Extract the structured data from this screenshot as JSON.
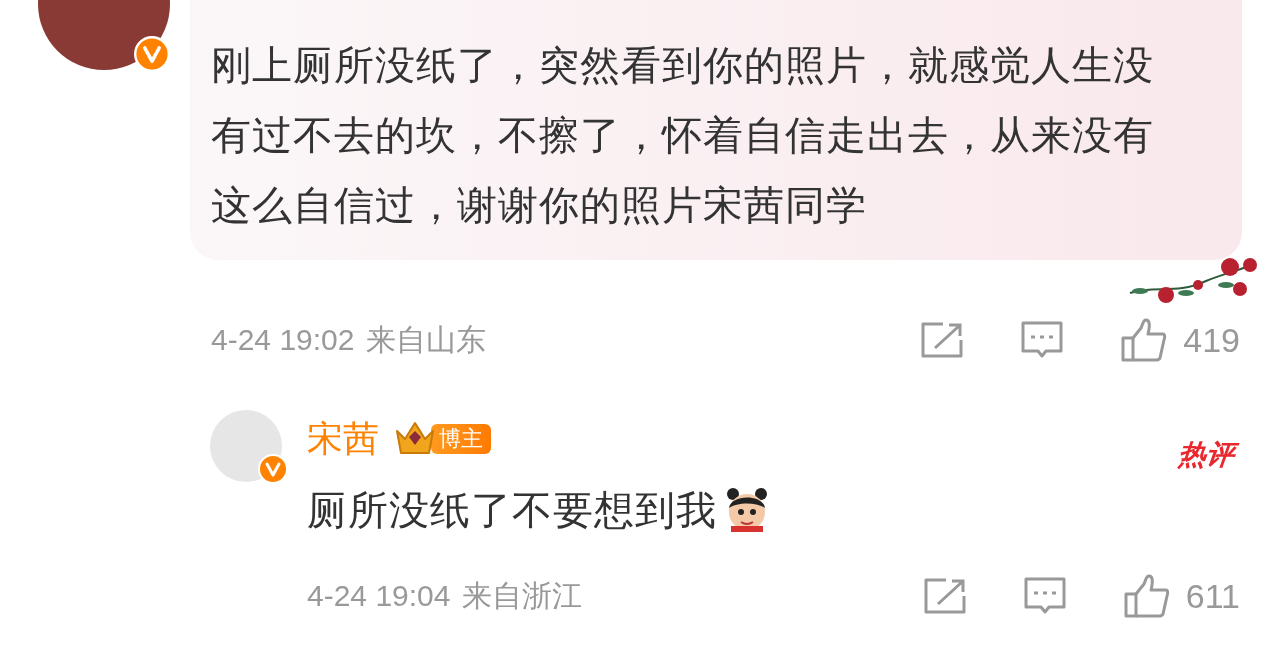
{
  "comment": {
    "text": "刚上厕所没纸了，突然看到你的照片，就感觉人生没有过不去的坎，不擦了，怀着自信走出去，从来没有这么自信过，谢谢你的照片宋茜同学",
    "time": "4-24 19:02",
    "location": "来自山东",
    "likes": "419"
  },
  "reply": {
    "author": "宋茜",
    "badge": "博主",
    "tag": "热评",
    "text": "厕所没纸了不要想到我",
    "time": "4-24 19:04",
    "location": "来自浙江",
    "likes": "611"
  }
}
